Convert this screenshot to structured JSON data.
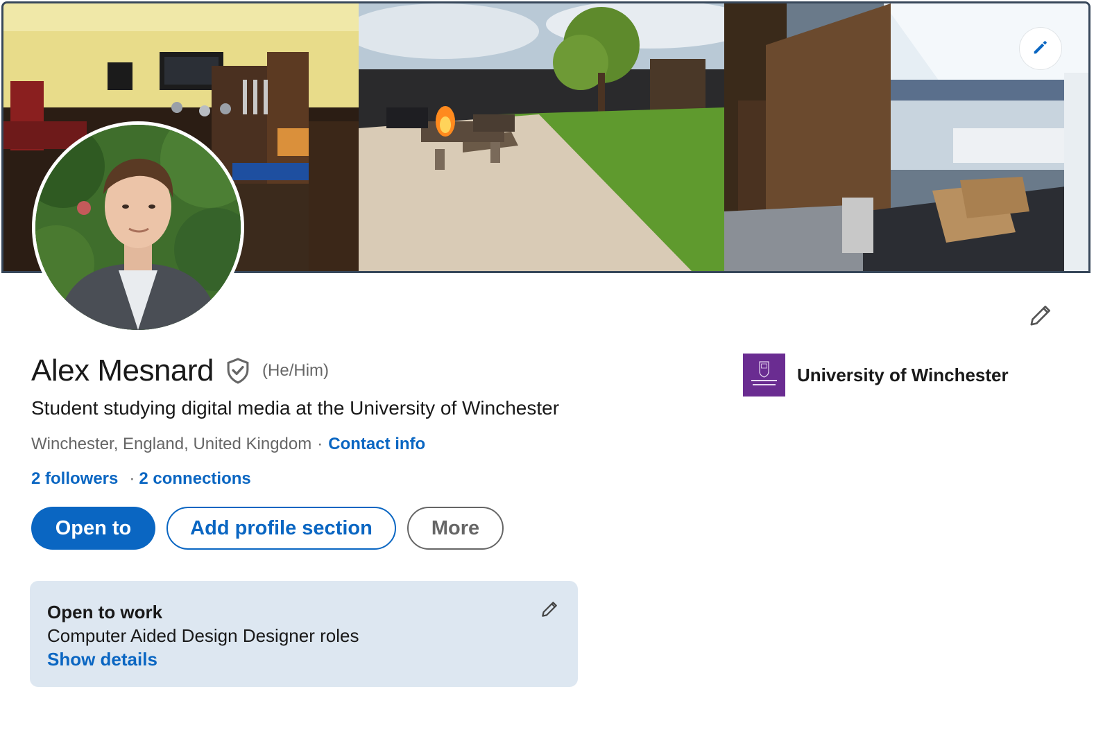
{
  "profile": {
    "name": "Alex Mesnard",
    "pronouns": "(He/Him)",
    "headline": "Student studying digital media at the University of Winchester",
    "location": "Winchester, England, United Kingdom",
    "location_separator": "·",
    "contact_info_label": "Contact info",
    "followers_label": "2 followers",
    "connections_separator": "·",
    "connections_label": "2 connections"
  },
  "actions": {
    "open_to_label": "Open to",
    "add_section_label": "Add profile section",
    "more_label": "More"
  },
  "open_to_work": {
    "title": "Open to work",
    "roles": "Computer Aided Design Designer roles",
    "show_details_label": "Show details"
  },
  "education": {
    "school_name": "University of Winchester"
  },
  "icons": {
    "banner_edit": "pencil-icon",
    "profile_edit": "pencil-icon",
    "verified": "verified-shield-icon",
    "otw_edit": "pencil-icon"
  },
  "colors": {
    "accent": "#0a66c2",
    "muted_text": "#666666",
    "card_background": "#dde7f1",
    "school_logo": "#6a2c91"
  }
}
